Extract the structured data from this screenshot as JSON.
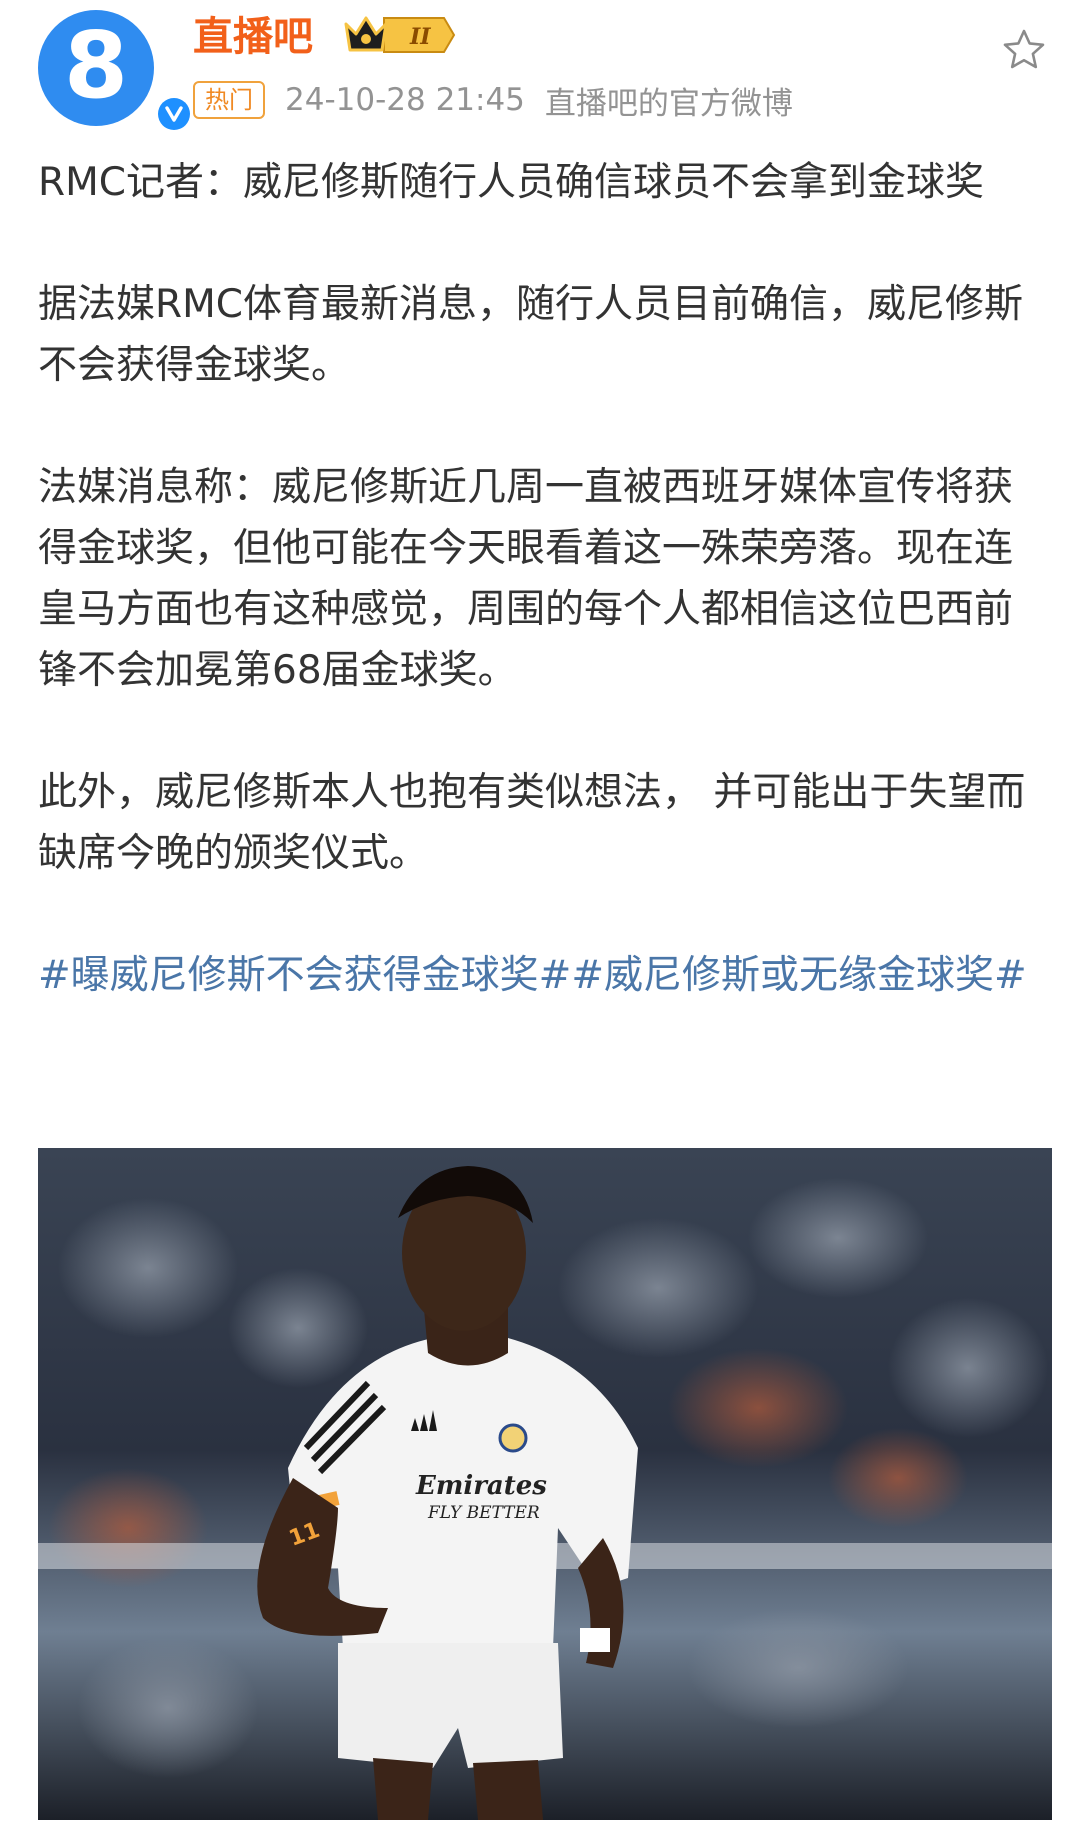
{
  "author": {
    "name": "直播吧",
    "avatar_glyph": "8",
    "vip_level": "II",
    "avatar_color": "#2f8cf0",
    "name_color": "#f2601a"
  },
  "meta": {
    "tag": "热门",
    "timestamp": "24-10-28 21:45",
    "source": "直播吧的官方微博"
  },
  "post": {
    "paragraphs": [
      "RMC记者：威尼修斯随行人员确信球员不会拿到金球奖",
      "据法媒RMC体育最新消息，随行人员目前确信，威尼修斯不会获得金球奖。",
      "法媒消息称：威尼修斯近几周一直被西班牙媒体宣传将获得金球奖，但他可能在今天眼看着这一殊荣旁落。现在连皇马方面也有这种感觉，周围的每个人都相信这位巴西前锋不会加冕第68届金球奖。",
      "此外，威尼修斯本人也抱有类似想法， 并可能出于失望而缺席今晚的颁奖仪式。"
    ],
    "hashtags": [
      "#曝威尼修斯不会获得金球奖#",
      "#威尼修斯或无缘金球奖#"
    ],
    "hashtag_color": "#4a76a8"
  },
  "photo": {
    "jersey_text_line1": "Emirates",
    "jersey_text_line2": "FLY BETTER",
    "jersey_number": "11"
  },
  "icons": {
    "favorite": "star-outline-icon",
    "verified": "verified-v-icon",
    "vip": "crown-icon"
  }
}
